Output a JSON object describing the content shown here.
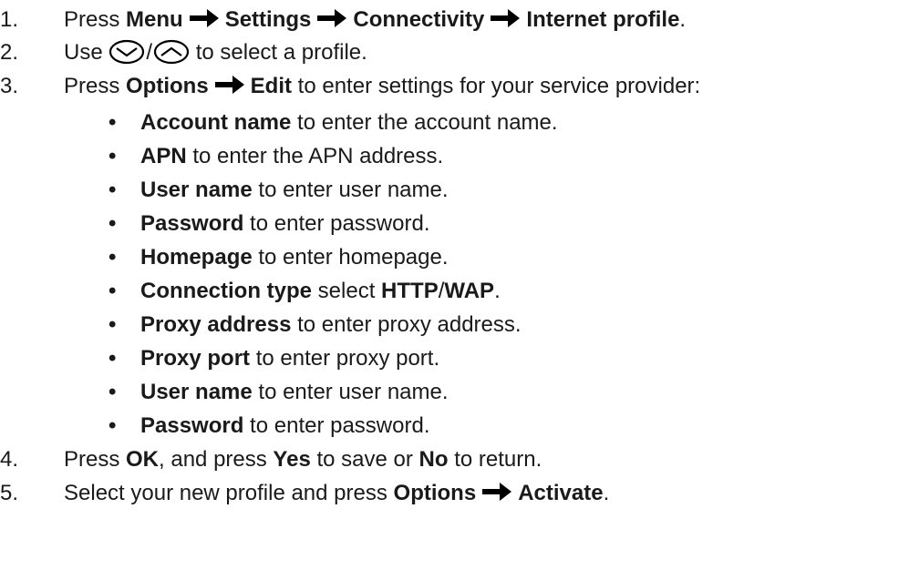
{
  "steps": [
    {
      "num": "1.",
      "p1": "Press ",
      "b1": "Menu",
      "b2": "Settings",
      "b3": "Connectivity",
      "b4": "Internet profile",
      "end": "."
    },
    {
      "num": "2.",
      "p1": "Use ",
      "slash": "/",
      "p2": " to select a profile."
    },
    {
      "num": "3.",
      "p1": "Press ",
      "b1": "Options",
      "b2": "Edit",
      "p2": " to enter settings for your service provider:"
    },
    {
      "num": "4.",
      "p1": "Press ",
      "b1": "OK",
      "p2": ", and press ",
      "b2": "Yes",
      "p3": " to save or ",
      "b3": "No",
      "p4": " to return."
    },
    {
      "num": "5.",
      "p1": "Select your new profile and press ",
      "b1": "Options",
      "b2": "Activate",
      "end": "."
    }
  ],
  "bullets": [
    {
      "bold": "Account name",
      "rest": " to enter the account name."
    },
    {
      "bold": "APN",
      "rest": " to enter the APN address."
    },
    {
      "bold": "User name",
      "rest": " to enter user name."
    },
    {
      "bold": "Password",
      "rest": " to enter password."
    },
    {
      "bold": "Homepage",
      "rest": " to enter homepage."
    },
    {
      "bold": "Connection type",
      "rest": " select ",
      "bold2": "HTTP",
      "mid": "/",
      "bold3": "WAP",
      "end": "."
    },
    {
      "bold": "Proxy address",
      "rest": " to enter proxy address."
    },
    {
      "bold": "Proxy port",
      "rest": " to enter proxy port."
    },
    {
      "bold": "User name",
      "rest": " to enter user name."
    },
    {
      "bold": "Password",
      "rest": " to enter password."
    }
  ],
  "bullet_symbol": "•",
  "icons": {
    "arrow": "right-arrow-icon",
    "nav_down": "nav-down-key-icon",
    "nav_up": "nav-up-key-icon"
  }
}
